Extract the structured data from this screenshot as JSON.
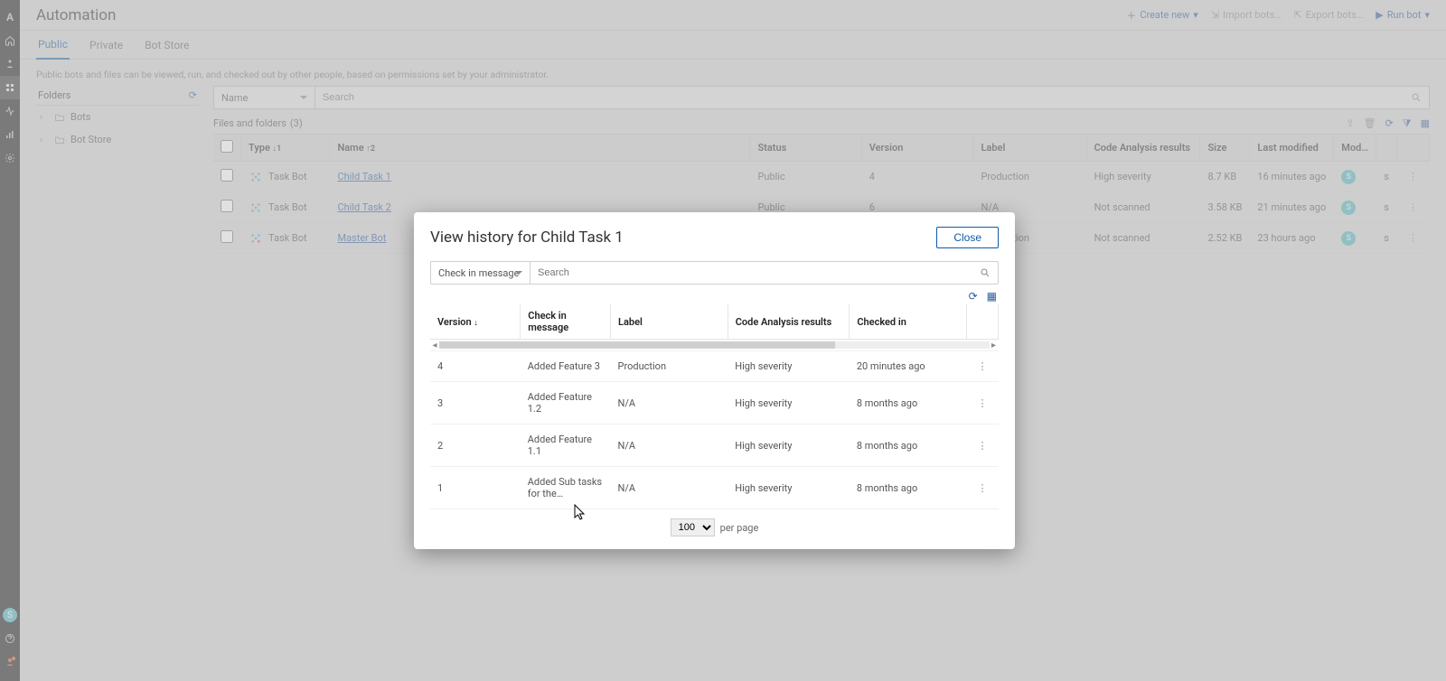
{
  "header": {
    "title": "Automation",
    "actions": {
      "create": "Create new",
      "import": "Import bots…",
      "export": "Export bots…",
      "run": "Run bot"
    }
  },
  "tabs": [
    "Public",
    "Private",
    "Bot Store"
  ],
  "active_tab": "Public",
  "helpline": "Public bots and files can be viewed, run, and checked out by other people, based on permissions set by your administrator.",
  "sidebar": {
    "title": "Folders",
    "items": [
      "Bots",
      "Bot Store"
    ]
  },
  "content": {
    "filter_field": "Name",
    "search_placeholder": "Search",
    "list_title": "Files and folders",
    "list_count": "(3)",
    "columns": {
      "type": "Type",
      "name": "Name",
      "status": "Status",
      "version": "Version",
      "label": "Label",
      "code": "Code Analysis results",
      "size": "Size",
      "last_modified": "Last modified",
      "modified_by": "Mod…"
    },
    "rows": [
      {
        "type": "Task Bot",
        "name": "Child Task 1",
        "status": "Public",
        "version": "4",
        "label": "Production",
        "code": "High severity",
        "size": "8.7 KB",
        "lm": "16 minutes ago",
        "mod": "s"
      },
      {
        "type": "Task Bot",
        "name": "Child Task 2",
        "status": "Public",
        "version": "6",
        "label": "N/A",
        "code": "Not scanned",
        "size": "3.58 KB",
        "lm": "21 minutes ago",
        "mod": "s"
      },
      {
        "type": "Task Bot",
        "name": "Master Bot",
        "status": "",
        "version": "",
        "label": "Production",
        "code": "Not scanned",
        "size": "2.52 KB",
        "lm": "23 hours ago",
        "mod": "s"
      }
    ]
  },
  "modal": {
    "title": "View history for Child Task 1",
    "close_label": "Close",
    "filter_field": "Check in message",
    "search_placeholder": "Search",
    "columns": {
      "version": "Version",
      "message": "Check in message",
      "label": "Label",
      "code": "Code Analysis results",
      "checked_in": "Checked in"
    },
    "rows": [
      {
        "version": "4",
        "message": "Added Feature 3",
        "label": "Production",
        "code": "High severity",
        "checked_in": "20 minutes ago"
      },
      {
        "version": "3",
        "message": "Added Feature 1.2",
        "label": "N/A",
        "code": "High severity",
        "checked_in": "8 months ago"
      },
      {
        "version": "2",
        "message": "Added Feature 1.1",
        "label": "N/A",
        "code": "High severity",
        "checked_in": "8 months ago"
      },
      {
        "version": "1",
        "message": "Added Sub tasks for the…",
        "label": "N/A",
        "code": "High severity",
        "checked_in": "8 months ago"
      }
    ],
    "page_size": "100",
    "per_page_label": "per page"
  }
}
